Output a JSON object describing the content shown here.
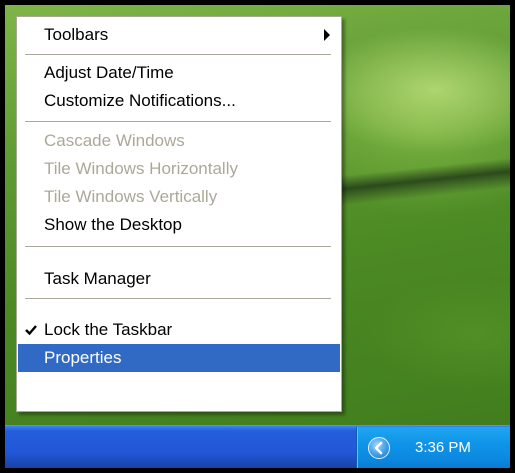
{
  "menu": {
    "items": [
      {
        "label": "Toolbars",
        "submenu": true
      },
      {
        "label": "Adjust Date/Time"
      },
      {
        "label": "Customize Notifications..."
      },
      {
        "label": "Cascade Windows",
        "enabled": false
      },
      {
        "label": "Tile Windows Horizontally",
        "enabled": false
      },
      {
        "label": "Tile Windows Vertically",
        "enabled": false
      },
      {
        "label": "Show the Desktop"
      },
      {
        "label": "Task Manager"
      },
      {
        "label": "Lock the Taskbar",
        "checked": true
      },
      {
        "label": "Properties",
        "highlighted": true
      }
    ]
  },
  "taskbar": {
    "clock": "3:36 PM",
    "tray_chevron_icon": "left-chevron-icon"
  },
  "colors": {
    "menu_highlight": "#316ac5",
    "disabled_text": "#aca899",
    "taskbar": "#245edb",
    "tray": "#0f94e8"
  }
}
